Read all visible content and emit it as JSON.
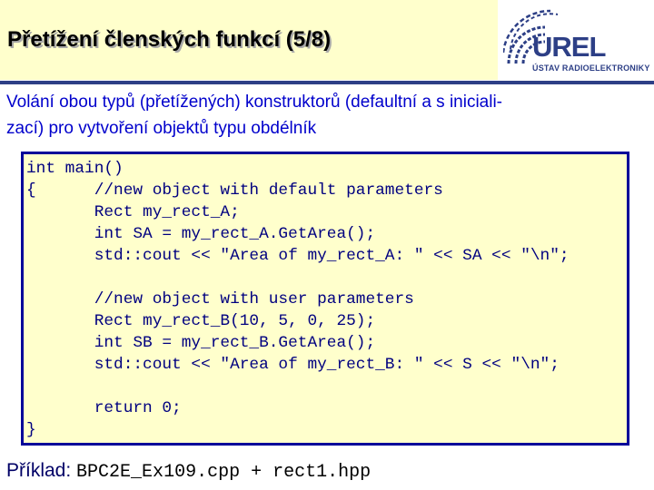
{
  "slide": {
    "title": "Přetížení členských funkcí (5/8)",
    "logo": {
      "name": "UREL",
      "subtitle": "ÚSTAV RADIOELEKTRONIKY"
    },
    "intro_lines": [
      "Volání obou typů (přetížených) konstruktorů (defaultní a s iniciali-",
      "zací) pro vytvoření objektů typu obdélník"
    ],
    "code_lines": [
      "int main()",
      "{      //new object with default parameters",
      "       Rect my_rect_A;",
      "       int SA = my_rect_A.GetArea();",
      "       std::cout << \"Area of my_rect_A: \" << SA << \"\\n\";",
      "",
      "       //new object with user parameters",
      "       Rect my_rect_B(10, 5, 0, 25);",
      "       int SB = my_rect_B.GetArea();",
      "       std::cout << \"Area of my_rect_B: \" << S << \"\\n\";",
      "",
      "       return 0;",
      "}"
    ],
    "example": {
      "label": "Příklad:",
      "file": "BPC2E_Ex109.cpp + rect1.hpp"
    }
  },
  "colors": {
    "title_band": "#ffffcc",
    "rule": "#2d3f86",
    "intro_text": "#0000cc",
    "code_bg": "#ffffcc",
    "code_border": "#000099",
    "code_text": "#000080"
  }
}
